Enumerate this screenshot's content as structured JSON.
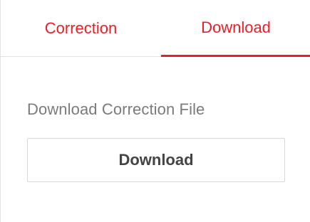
{
  "tabs": [
    {
      "label": "Correction",
      "active": false
    },
    {
      "label": "Download",
      "active": true
    }
  ],
  "accent_color": "#ee1c25",
  "section": {
    "title": "Download Correction File",
    "button_label": "Download"
  }
}
